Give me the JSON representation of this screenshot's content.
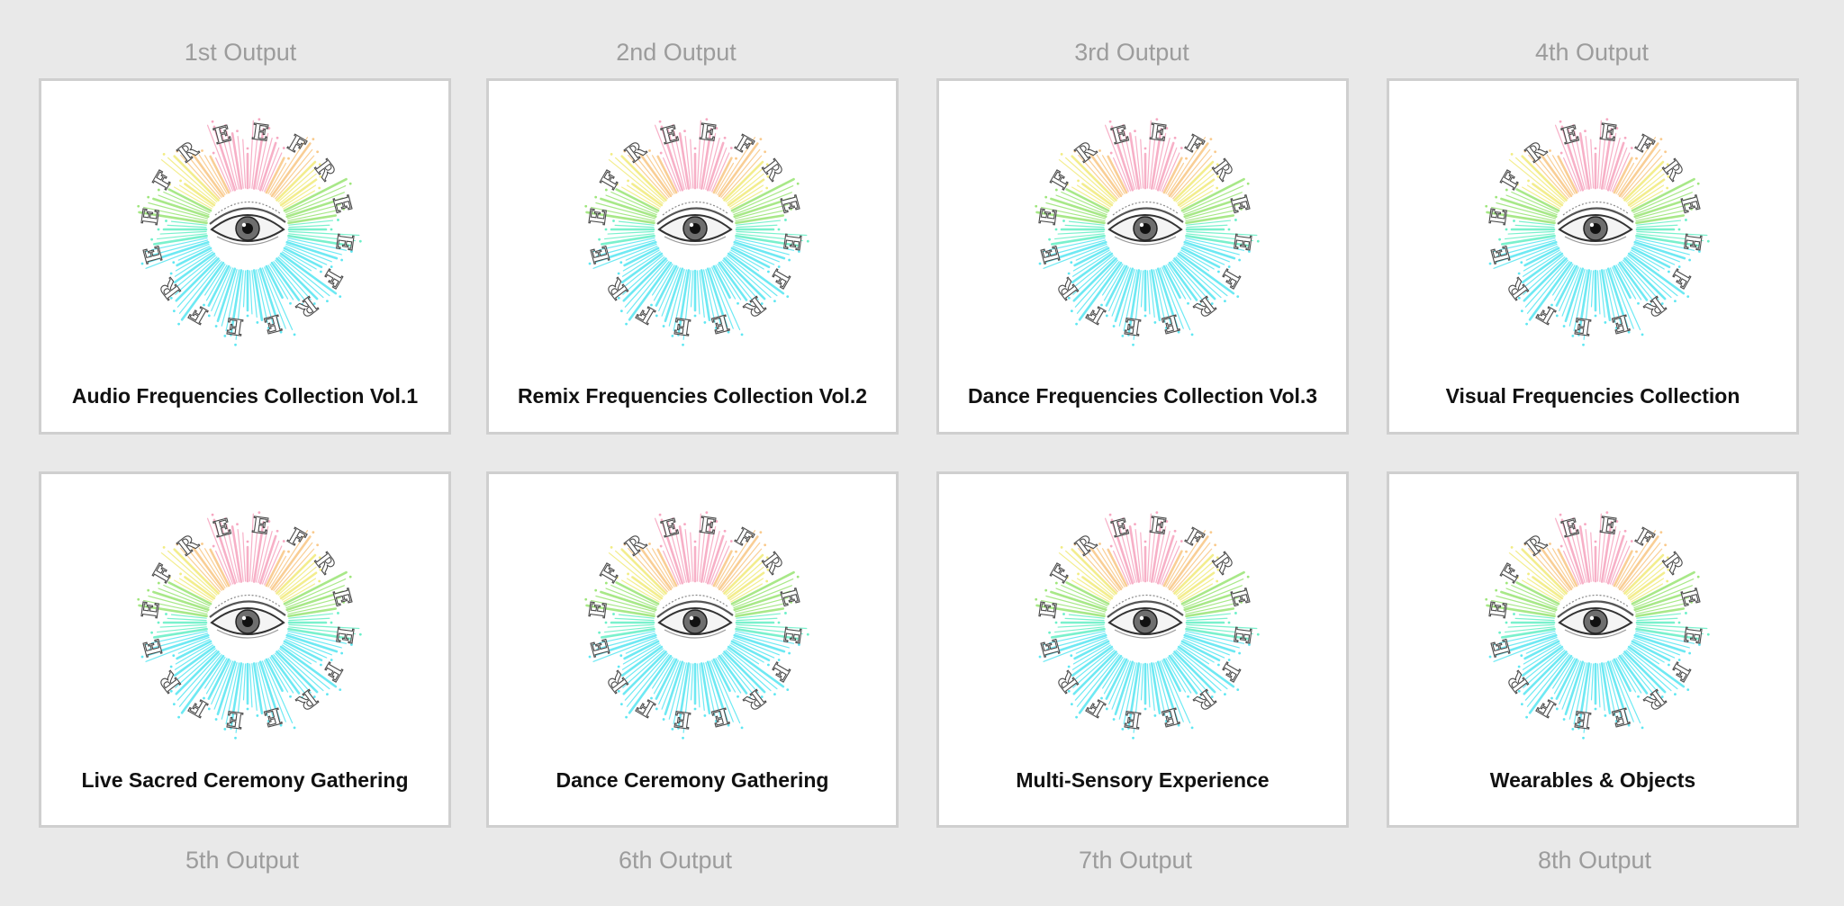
{
  "outputs": [
    {
      "label": "1st Output",
      "title": "Audio Frequencies Collection Vol.1"
    },
    {
      "label": "2nd Output",
      "title": "Remix Frequencies Collection Vol.2"
    },
    {
      "label": "3rd Output",
      "title": "Dance Frequencies Collection Vol.3"
    },
    {
      "label": "4th Output",
      "title": "Visual Frequencies Collection"
    },
    {
      "label": "5th Output",
      "title": "Live Sacred Ceremony Gathering"
    },
    {
      "label": "6th Output",
      "title": "Dance Ceremony Gathering"
    },
    {
      "label": "7th Output",
      "title": "Multi-Sensory Experience"
    },
    {
      "label": "8th Output",
      "title": "Wearables & Objects"
    }
  ],
  "logo": {
    "ring_text": "FREE",
    "icon": "eye-icon",
    "colors": [
      "#f7a8c2",
      "#f9c98a",
      "#f2ec82",
      "#9fe67c",
      "#6cf0c8",
      "#5fe7f2"
    ]
  }
}
